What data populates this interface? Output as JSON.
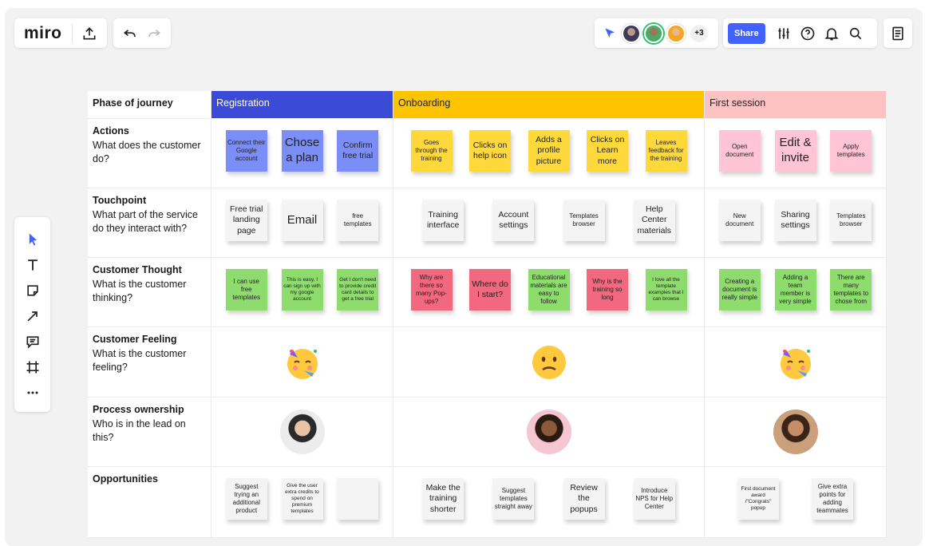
{
  "brand": {
    "logo": "miro"
  },
  "toolbar": {
    "share_label": "Share",
    "extra_collaborators": "+3"
  },
  "board": {
    "phase_label": "Phase of journey",
    "phases": [
      "Registration",
      "Onboarding",
      "First session"
    ],
    "rows": [
      {
        "title": "Actions",
        "question": "What does the customer do?"
      },
      {
        "title": "Touchpoint",
        "question": "What part of the service do they interact with?"
      },
      {
        "title": "Customer Thought",
        "question": "What is the customer thinking?"
      },
      {
        "title": "Customer Feeling",
        "question": "What is the customer feeling?"
      },
      {
        "title": "Process ownership",
        "question": "Who is in the lead on this?"
      },
      {
        "title": "Opportunities",
        "question": ""
      }
    ],
    "notes": {
      "actions": [
        [
          "Connect their Google account",
          "Chose a plan",
          "Confirm free trial"
        ],
        [
          "Goes through the training",
          "Clicks on help icon",
          "Adds a profile picture",
          "Clicks on Learn more",
          "Leaves feedback for the training"
        ],
        [
          "Open document",
          "Edit & invite",
          "Apply templates"
        ]
      ],
      "touchpoint": [
        [
          "Free trial landing page",
          "Email",
          "free templates"
        ],
        [
          "Training interface",
          "Account settings",
          "Templates browser",
          "Help Center materials"
        ],
        [
          "New document",
          "Sharing settings",
          "Templates browser"
        ]
      ],
      "thought": [
        [
          "I can use free templates",
          "This is easy, I can sign up with my google account",
          "Get I don't need to provide credit card details to get a free trial"
        ],
        [
          "Why are there so many Pop-ups?",
          "Where do I start?",
          "Educational materials are easy to follow",
          "Why is the training so long",
          "I love all the template examples that I can browse"
        ],
        [
          "Creating a document is really simple",
          "Adding a team member is very simple",
          "There are many templates to chose from"
        ]
      ],
      "opportunities": [
        [
          "Suggest trying an additional product",
          "Give the user extra credits to spend on premium templates",
          ""
        ],
        [
          "Make the training shorter",
          "Suggest templates straight away",
          "Review the popups",
          "Introduce NPS for Help Center"
        ],
        [
          "First document award /\"Congrats\" popup",
          "Give extra points for adding teammates"
        ]
      ]
    }
  },
  "colors": {
    "registration": "#3b4bd8",
    "onboarding": "#ffc400",
    "first_session": "#ffc2c2",
    "share": "#4262ff"
  }
}
